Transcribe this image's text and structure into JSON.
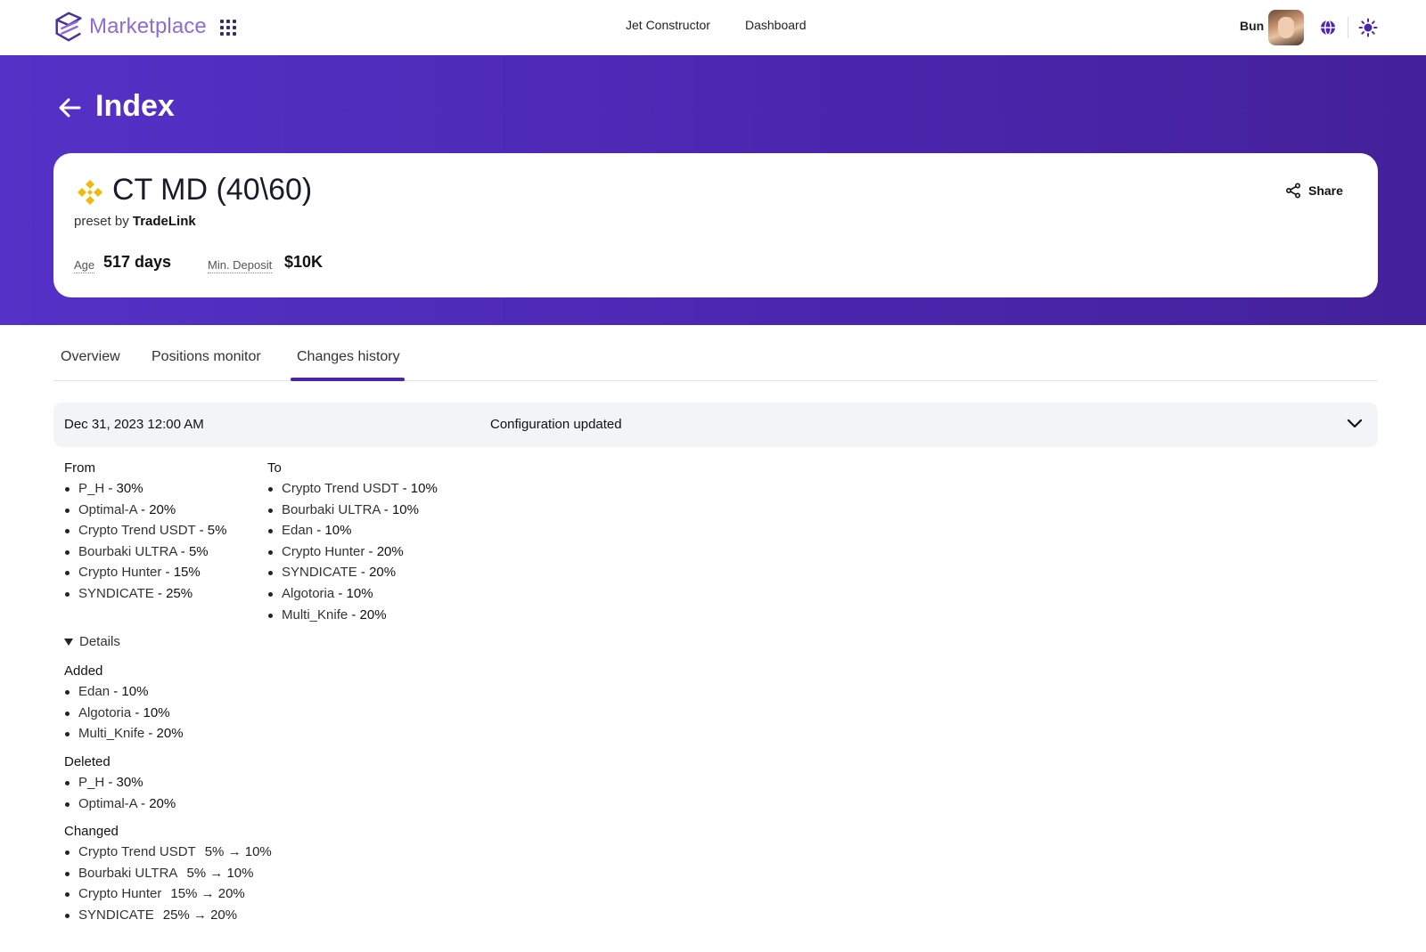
{
  "brand": {
    "name": "Marketplace",
    "accent": "#8e6bd8",
    "hero_color": "#4b27b0"
  },
  "nav": {
    "links": [
      "Jet Constructor",
      "Dashboard"
    ]
  },
  "user": {
    "name": "Bun"
  },
  "page": {
    "title": "Index"
  },
  "preset": {
    "name": "CT MD (40\\60)",
    "by_prefix": "preset by",
    "author": "TradeLink",
    "age_label": "Age",
    "age_value": "517 days",
    "deposit_label": "Min. Deposit",
    "deposit_value": "$10K",
    "share_label": "Share"
  },
  "tabs": [
    {
      "label": "Overview",
      "active": false
    },
    {
      "label": "Positions monitor",
      "active": false
    },
    {
      "label": "Changes history",
      "active": true
    }
  ],
  "change": {
    "date": "Dec 31, 2023 12:00 AM",
    "title": "Configuration updated",
    "from_label": "From",
    "to_label": "To",
    "from": [
      {
        "name": "P_H",
        "pct": "30%"
      },
      {
        "name": "Optimal-A",
        "pct": "20%"
      },
      {
        "name": "Crypto Trend USDT",
        "pct": "5%"
      },
      {
        "name": "Bourbaki ULTRA",
        "pct": "5%"
      },
      {
        "name": "Crypto Hunter",
        "pct": "15%"
      },
      {
        "name": "SYNDICATE",
        "pct": "25%"
      }
    ],
    "to": [
      {
        "name": "Crypto Trend USDT",
        "pct": "10%"
      },
      {
        "name": "Bourbaki ULTRA",
        "pct": "10%"
      },
      {
        "name": "Edan",
        "pct": "10%"
      },
      {
        "name": "Crypto Hunter",
        "pct": "20%"
      },
      {
        "name": "SYNDICATE",
        "pct": "20%"
      },
      {
        "name": "Algotoria",
        "pct": "10%"
      },
      {
        "name": "Multi_Knife",
        "pct": "20%"
      }
    ],
    "details_label": "Details",
    "added_label": "Added",
    "added": [
      {
        "name": "Edan",
        "pct": "10%"
      },
      {
        "name": "Algotoria",
        "pct": "10%"
      },
      {
        "name": "Multi_Knife",
        "pct": "20%"
      }
    ],
    "deleted_label": "Deleted",
    "deleted": [
      {
        "name": "P_H",
        "pct": "30%"
      },
      {
        "name": "Optimal-A",
        "pct": "20%"
      }
    ],
    "changed_label": "Changed",
    "changed": [
      {
        "name": "Crypto Trend USDT",
        "delta": "5% → 10%"
      },
      {
        "name": "Bourbaki ULTRA",
        "delta": "5% → 10%"
      },
      {
        "name": "Crypto Hunter",
        "delta": "15% → 20%"
      },
      {
        "name": "SYNDICATE",
        "delta": "25% → 20%"
      }
    ]
  }
}
